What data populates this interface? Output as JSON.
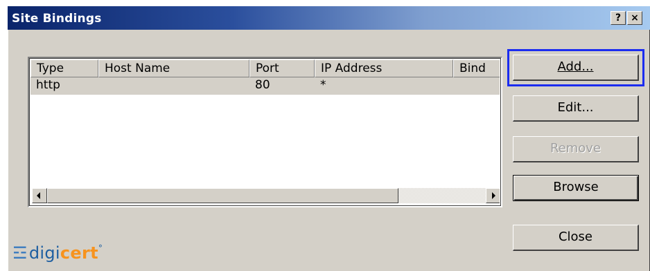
{
  "window": {
    "title": "Site Bindings",
    "help_label": "?",
    "close_label": "×"
  },
  "list": {
    "columns": [
      "Type",
      "Host Name",
      "Port",
      "IP Address",
      "Bind"
    ],
    "rows": [
      {
        "type": "http",
        "host_name": "",
        "port": "80",
        "ip_address": "*"
      }
    ]
  },
  "buttons": {
    "add": "Add...",
    "edit": "Edit...",
    "remove": "Remove",
    "browse": "Browse",
    "close": "Close"
  },
  "logo": {
    "mark": "☲",
    "part1": "digi",
    "part2": "cert",
    "trademark": "°"
  },
  "colors": {
    "title_gradient_start": "#0a246a",
    "focus_ring": "#1b2cf0",
    "logo_orange": "#f7931e"
  }
}
